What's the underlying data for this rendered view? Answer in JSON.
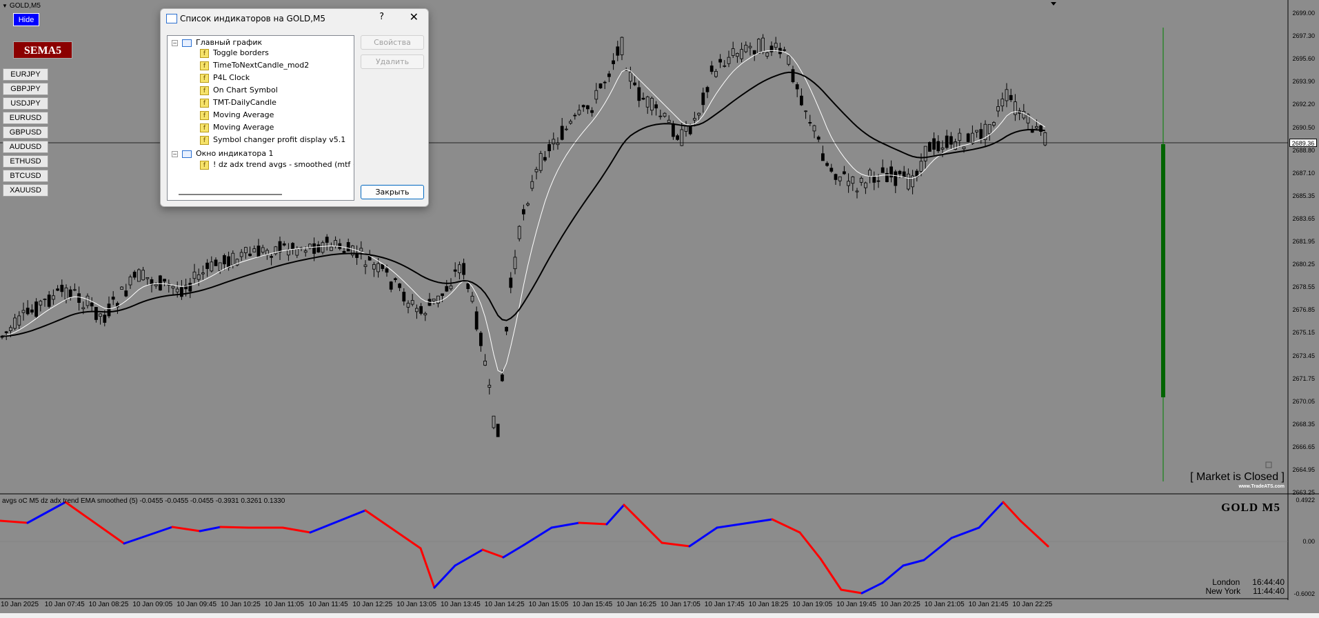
{
  "chart": {
    "title": "GOLD,M5",
    "hide_label": "Hide",
    "sema_label": "SEMA5",
    "symbols": [
      "EURJPY",
      "GBPJPY",
      "USDJPY",
      "EURUSD",
      "GBPUSD",
      "AUDUSD",
      "ETHUSD",
      "BTCUSD",
      "XAUUSD"
    ],
    "current_price": "2689.36",
    "price_axis": [
      "2699.00",
      "2697.30",
      "2695.60",
      "2693.90",
      "2692.20",
      "2690.50",
      "2688.80",
      "2687.10",
      "2685.35",
      "2683.65",
      "2681.95",
      "2680.25",
      "2678.55",
      "2676.85",
      "2675.15",
      "2673.45",
      "2671.75",
      "2670.05",
      "2668.35",
      "2666.65",
      "2664.95",
      "2663.25"
    ],
    "time_axis": [
      "10 Jan 2025",
      "10 Jan 07:45",
      "10 Jan 08:25",
      "10 Jan 09:05",
      "10 Jan 09:45",
      "10 Jan 10:25",
      "10 Jan 11:05",
      "10 Jan 11:45",
      "10 Jan 12:25",
      "10 Jan 13:05",
      "10 Jan 13:45",
      "10 Jan 14:25",
      "10 Jan 15:05",
      "10 Jan 15:45",
      "10 Jan 16:25",
      "10 Jan 17:05",
      "10 Jan 17:45",
      "10 Jan 18:25",
      "10 Jan 19:05",
      "10 Jan 19:45",
      "10 Jan 20:25",
      "10 Jan 21:05",
      "10 Jan 21:45",
      "10 Jan 22:25"
    ],
    "market_status": "[ Market is Closed ]",
    "brand": "www.TradeATS.com",
    "indicator_header": "avgs oC M5 dz adx trend EMA smoothed (5) -0.0455 -0.0455 -0.0455 -0.3931 0.3261 0.1330",
    "indicator_axis": [
      "0.4922",
      "0.00",
      "-0.6002"
    ],
    "symbol_label": "GOLD  M5",
    "clocks": [
      {
        "city": "London",
        "time": "16:44:40"
      },
      {
        "city": "New York",
        "time": "11:44:40"
      }
    ],
    "colors": {
      "bull_line": "#0000ff",
      "bear_line": "#ff0000",
      "signal_bar": "#006400"
    }
  },
  "dialog": {
    "title": "Список индикаторов на GOLD,M5",
    "help": "?",
    "close": "✕",
    "groups": [
      {
        "label": "Главный график",
        "items": [
          "Toggle borders",
          "TimeToNextCandle_mod2",
          "P4L Clock",
          "On Chart Symbol",
          "TMT-DailyCandle",
          "Moving Average",
          "Moving Average",
          "Symbol changer profit display v5.1"
        ]
      },
      {
        "label": "Окно индикатора 1",
        "items": [
          "! dz adx trend avgs - smoothed (mtf + ale"
        ]
      }
    ],
    "properties_label": "Свойства",
    "delete_label": "Удалить",
    "close_label": "Закрыть"
  }
}
